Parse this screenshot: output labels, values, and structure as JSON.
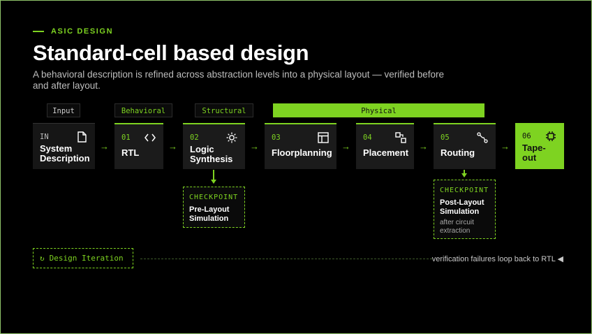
{
  "header": {
    "eyebrow": "ASIC DESIGN",
    "title": "Standard-cell based design",
    "subtitle": "A behavioral description is refined across abstraction levels into a physical layout — verified before and after layout."
  },
  "stages": {
    "input": "Input",
    "behavioral": "Behavioral",
    "structural": "Structural",
    "physical": "Physical"
  },
  "steps": [
    {
      "num": "IN",
      "label": "System Description",
      "icon": "document-icon"
    },
    {
      "num": "01",
      "label": "RTL",
      "icon": "code-brackets-icon"
    },
    {
      "num": "02",
      "label": "Logic Synthesis",
      "icon": "sun-gear-icon"
    },
    {
      "num": "03",
      "label": "Floorplanning",
      "icon": "layout-grid-icon"
    },
    {
      "num": "04",
      "label": "Placement",
      "icon": "placement-icon"
    },
    {
      "num": "05",
      "label": "Routing",
      "icon": "route-icon"
    },
    {
      "num": "06",
      "label": "Tape-out",
      "icon": "chip-icon"
    }
  ],
  "arrow": "→",
  "checkpoints": [
    {
      "heading": "CHECKPOINT",
      "title": "Pre-Layout Simulation",
      "note": ""
    },
    {
      "heading": "CHECKPOINT",
      "title": "Post-Layout Simulation",
      "note": "after circuit extraction"
    }
  ],
  "iteration": {
    "icon": "refresh-icon",
    "glyph": "↻",
    "label": "Design Iteration",
    "note": "verification failures loop back to RTL ◀"
  },
  "colors": {
    "accent": "#7ed321",
    "background": "#000000",
    "box": "#1b1b1b"
  }
}
